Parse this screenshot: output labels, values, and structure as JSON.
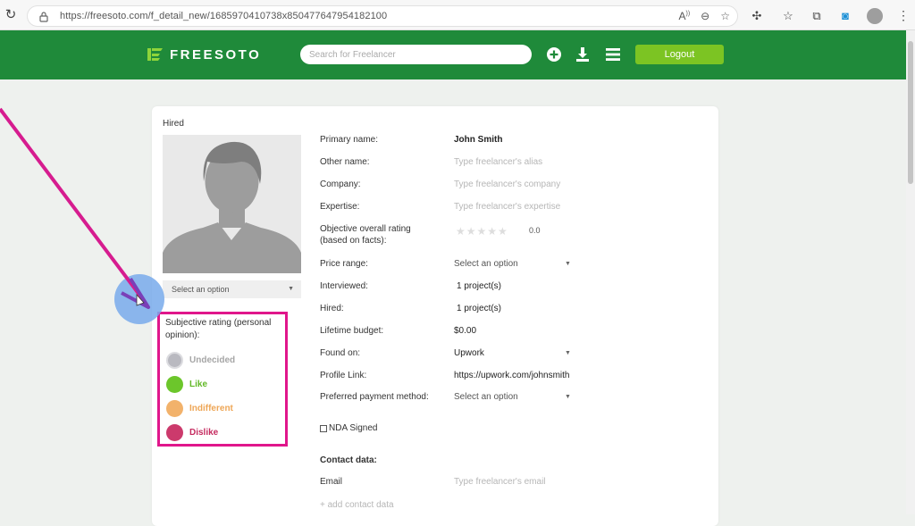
{
  "browser": {
    "url": "https://freesoto.com/f_detail_new/1685970410738x850477647954182100"
  },
  "header": {
    "logo_text": "FREESOTO",
    "search_placeholder": "Search for Freelancer",
    "logout_label": "Logout",
    "brand_color": "#1f8a3a",
    "accent_color": "#7cc423"
  },
  "profile": {
    "status_label": "Hired",
    "avatar_select": "Select an option",
    "fields": {
      "primary_name_label": "Primary name:",
      "primary_name_value": "John Smith",
      "other_name_label": "Other name:",
      "other_name_placeholder": "Type freelancer's alias",
      "company_label": "Company:",
      "company_placeholder": "Type freelancer's company",
      "expertise_label": "Expertise:",
      "expertise_placeholder": "Type freelancer's expertise",
      "rating_label_1": "Objective overall rating",
      "rating_label_2": "(based on facts):",
      "rating_value": "0.0",
      "rating_stars": 0,
      "price_label": "Price range:",
      "price_value": "Select an option",
      "interviewed_label": "Interviewed:",
      "interviewed_value": "1 project(s)",
      "hired_label": "Hired:",
      "hired_value": "1 project(s)",
      "budget_label": "Lifetime budget:",
      "budget_value": "$0.00",
      "found_label": "Found on:",
      "found_value": "Upwork",
      "profile_link_label": "Profile Link:",
      "profile_link_value": "https://upwork.com/johnsmith",
      "payment_label": "Preferred payment method:",
      "payment_value": "Select an option",
      "nda_label": "NDA Signed",
      "contact_heading": "Contact data:",
      "email_label": "Email",
      "email_placeholder": "Type freelancer's email",
      "add_contact": "+ add contact data"
    }
  },
  "subjective": {
    "title": "Subjective rating (personal opinion):",
    "options": [
      {
        "label": "Undecided",
        "color": "#b9b9c0",
        "text_color": "#a6a6a6"
      },
      {
        "label": "Like",
        "color": "#6cc62b",
        "text_color": "#62b827"
      },
      {
        "label": "Indifferent",
        "color": "#f2b26b",
        "text_color": "#eea656"
      },
      {
        "label": "Dislike",
        "color": "#cc3a6c",
        "text_color": "#c52b5f"
      }
    ]
  }
}
